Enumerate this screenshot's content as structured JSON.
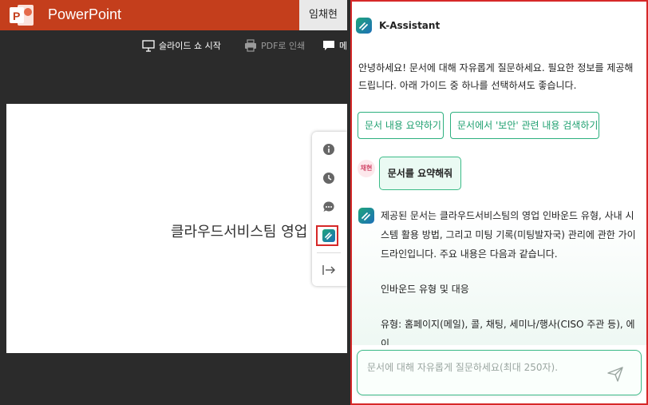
{
  "ppt": {
    "app_name": "PowerPoint",
    "user": "임채현",
    "toolbar": {
      "slideshow": "슬라이드 쇼 시작",
      "pdf": "PDF로 인쇄",
      "comment": "메"
    },
    "slide_title": "클라우드서비스팀 영업",
    "rail": [
      "info-icon",
      "history-icon",
      "chat-icon",
      "assistant-icon",
      "collapse-icon"
    ]
  },
  "assistant": {
    "title": "K-Assistant",
    "greeting": "안녕하세요! 문서에 대해 자유롭게 질문하세요. 필요한 정보를 제공해 드립니다. 아래 가이드 중 하나를 선택하셔도 좋습니다.",
    "suggestions": [
      "문서 내용 요약하기",
      "문서에서 '보안' 관련 내용 검색하기"
    ],
    "user_avatar": "채현",
    "user_message": "문서를 요약해줘",
    "bot_lines": [
      "제공된 문서는 클라우드서비스팀의 영업 인바운드 유형, 사내 시스템 활용 방법, 그리고 미팅 기록(미팅발자국) 관리에 관한 가이드라인입니다. 주요 내용은 다음과 같습니다.",
      "인바운드 유형 및 대응",
      "유형: 홈페이지(메일), 콜, 채팅, 세미나/행사(CISO 주관 등), 에이"
    ],
    "input_placeholder": "문서에 대해 자유롭게 질문하세요(최대 250자).",
    "colors": {
      "accent": "#2db07f",
      "highlight_border": "#d62828",
      "ppt_brand": "#c43e1c"
    }
  }
}
